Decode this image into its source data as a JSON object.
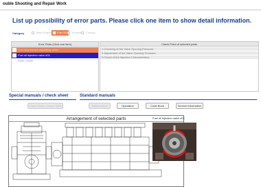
{
  "window": {
    "title": "ouble Shooting and Repair Work"
  },
  "heading": "List up possibility of error parts. Please click one item to show detail information.",
  "category": {
    "label": "Category",
    "options": [
      "Main Engine",
      "Fuel Oil",
      "Exhaust",
      "Cooling"
    ],
    "selected_index": 1
  },
  "error_parts": {
    "header": "Error Parts (Click one item)",
    "items": [
      "Fuel oil pressure regulating valve",
      "Fuel oil injection valve #01",
      "Enter Cause"
    ],
    "selected_index": 1
  },
  "check_points": {
    "header": "Check Point of selected parts",
    "items": [
      "1.Checking of the Valve Opening Pressure.",
      "2.Adjustment of the Valve Opening Pressure.",
      "3.Check of the Injection Characteristics."
    ]
  },
  "special_manuals": {
    "title": "Special manuals / check sheet",
    "button": "Check Sheet / Repair Work"
  },
  "standard_manuals": {
    "title": "Standard manuals",
    "buttons": [
      "Maintenance",
      "Operation",
      "Code Book",
      "Service Information"
    ]
  },
  "arrangement": {
    "title": "Arrangement of selected parts"
  },
  "selected_part_label": "Fuel oil injection valve #01",
  "colors": {
    "accent": "#1a3c8e",
    "selected_category": "#f08050",
    "selected_row": "#1e1ecf"
  }
}
